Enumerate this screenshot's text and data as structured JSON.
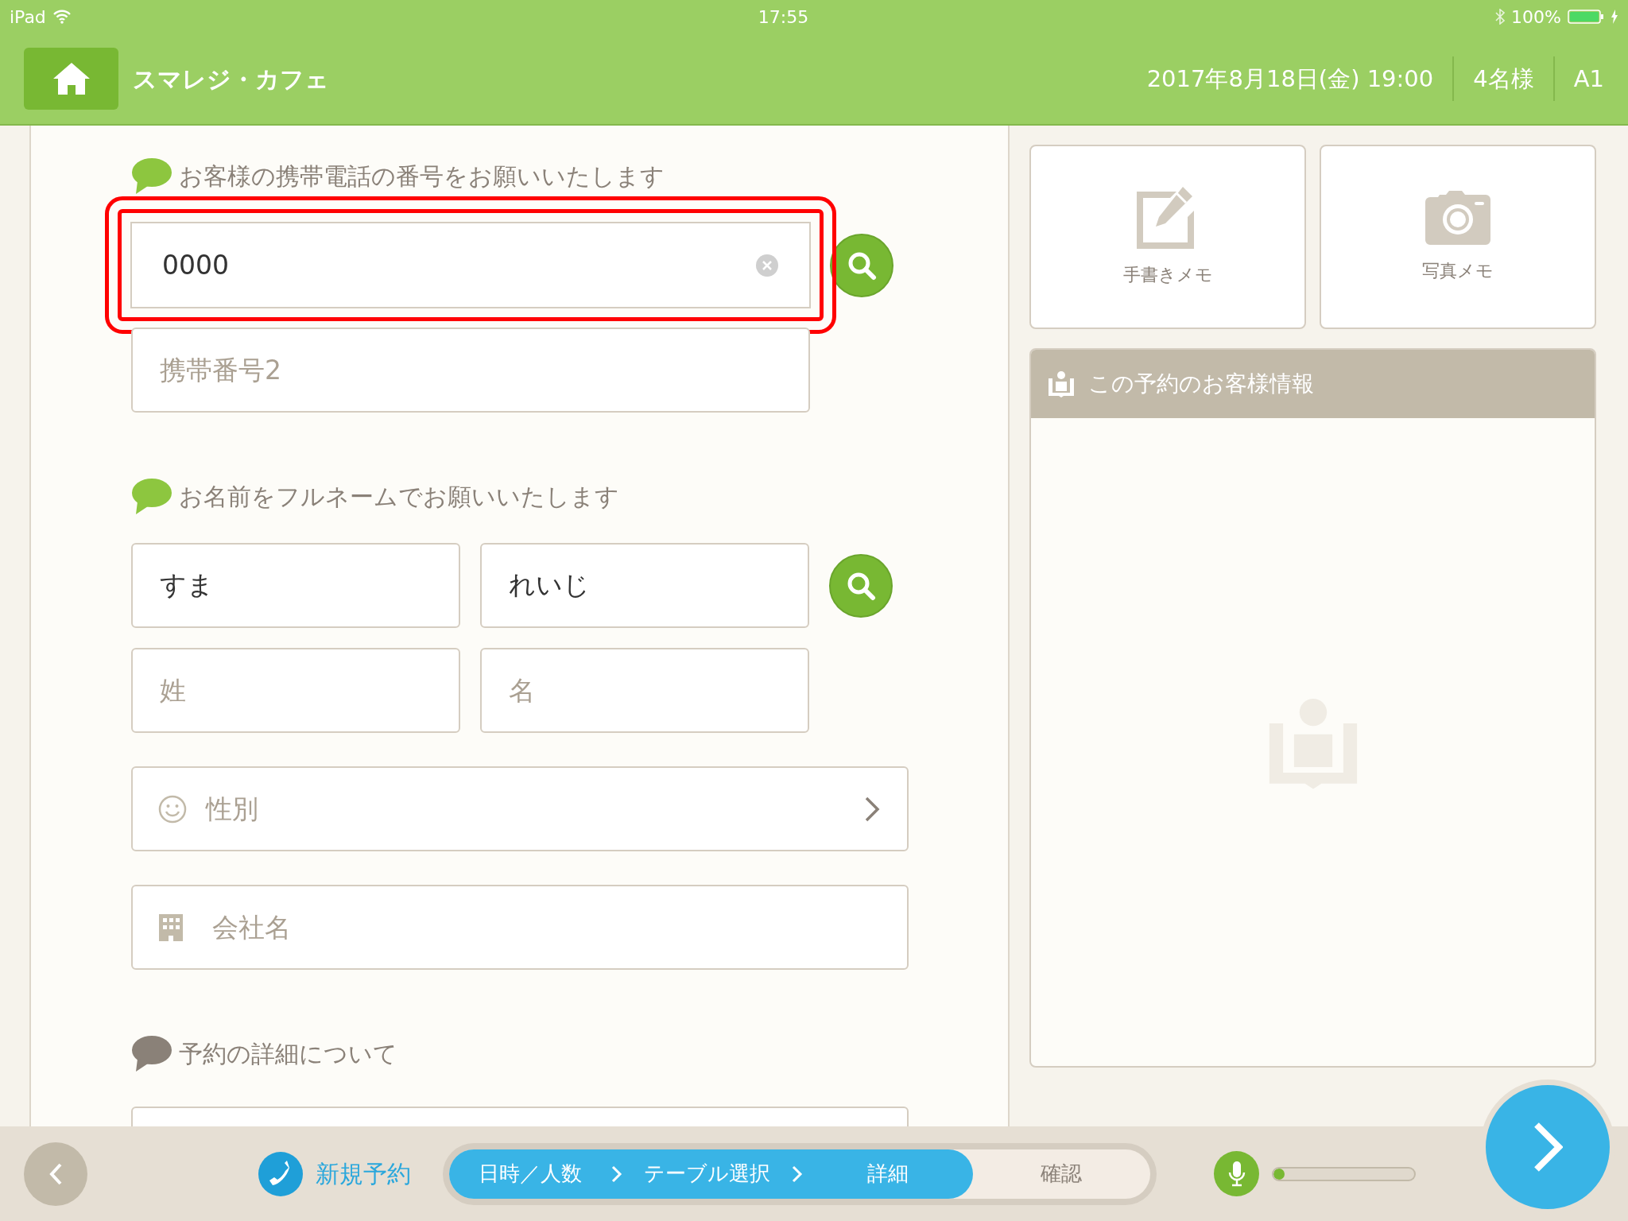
{
  "status_bar": {
    "device": "iPad",
    "time": "17:55",
    "battery": "100%"
  },
  "header": {
    "title": "スマレジ・カフェ",
    "datetime": "2017年8月18日(金) 19:00",
    "party": "4名様",
    "table": "A1"
  },
  "sections": [
    {
      "heading": "お客様の携帯電話の番号をお願いいたします",
      "color": "#8dc63f",
      "rows": [
        {
          "fields": [
            {
              "kind": "text",
              "value": "0000",
              "highlighted": true,
              "clearable": true
            }
          ],
          "search": true
        },
        {
          "fields": [
            {
              "kind": "text",
              "placeholder": "携帯番号2",
              "highlighted": false,
              "clearable": false
            }
          ],
          "search": false
        }
      ]
    },
    {
      "heading": "お名前をフルネームでお願いいたします",
      "color": "#8dc63f",
      "rows": [
        {
          "fields": [
            {
              "kind": "text",
              "value": "すま",
              "highlighted": false,
              "clearable": false
            },
            {
              "kind": "text",
              "value": "れいじ",
              "highlighted": false,
              "clearable": false
            }
          ],
          "search": true
        },
        {
          "fields": [
            {
              "kind": "text",
              "placeholder": "姓",
              "highlighted": false,
              "clearable": false
            },
            {
              "kind": "text",
              "placeholder": "名",
              "highlighted": false,
              "clearable": false
            }
          ],
          "search": false
        },
        {
          "fields": [
            {
              "kind": "select",
              "placeholder": "性別"
            }
          ],
          "search": false
        },
        {
          "fields": [
            {
              "kind": "company",
              "placeholder": "会社名",
              "highlighted": false,
              "clearable": false
            }
          ],
          "search": false
        }
      ]
    },
    {
      "heading": "予約の詳細について",
      "color": "#8a8178",
      "rows": [
        {
          "fields": [
            {
              "kind": "memo",
              "highlighted": false
            }
          ],
          "search": false
        }
      ]
    }
  ],
  "memo_buttons": [
    {
      "label": "手書きメモ"
    },
    {
      "label": "写真メモ"
    }
  ],
  "customer_panel": {
    "title": "この予約のお客様情報"
  },
  "footer": {
    "new_reservation": "新規予約",
    "steps": [
      {
        "label": "日時／人数",
        "completed": true
      },
      {
        "label": "テーブル選択",
        "completed": true
      },
      {
        "label": "詳細",
        "completed": true
      },
      {
        "label": "確認",
        "completed": false
      }
    ],
    "mic_level": {
      "level": 0.05
    }
  }
}
